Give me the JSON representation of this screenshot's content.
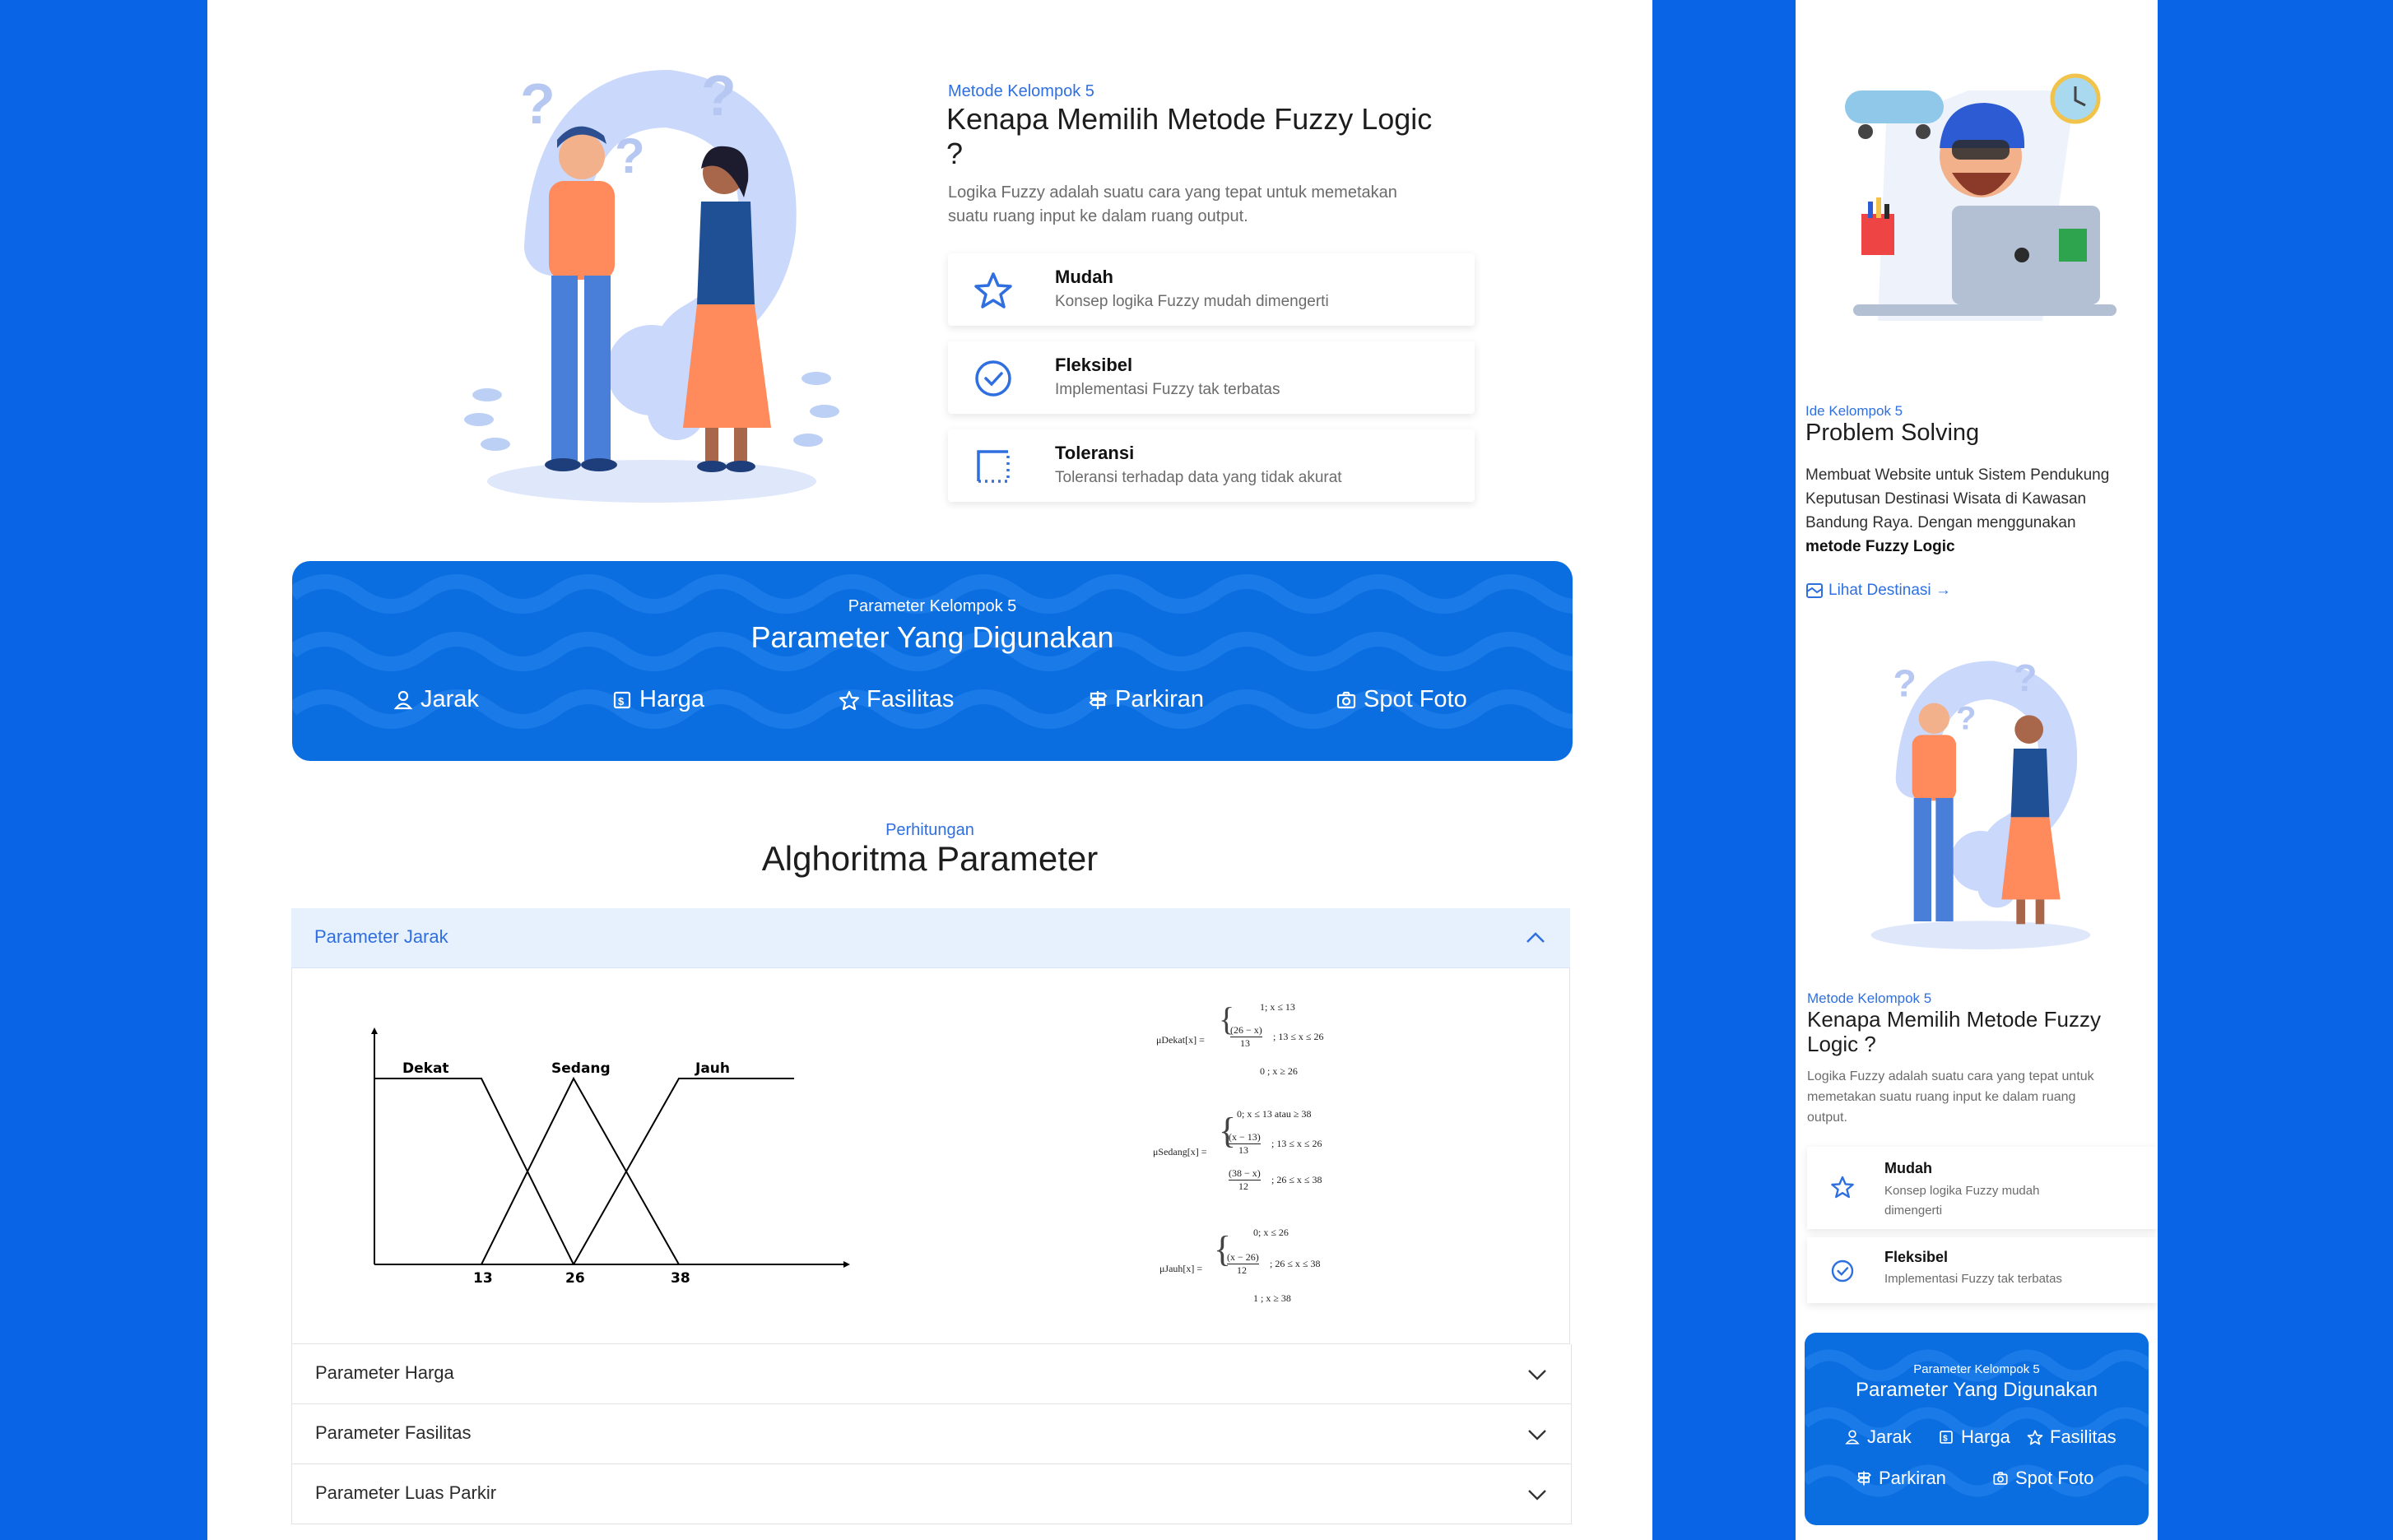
{
  "desktop": {
    "why": {
      "eyebrow": "Metode Kelompok 5",
      "title_line1": "Kenapa Memilih Metode Fuzzy Logic",
      "title_line2": "?",
      "desc_line1": "Logika Fuzzy adalah suatu cara yang tepat untuk memetakan",
      "desc_line2": "suatu ruang input ke dalam ruang output.",
      "features": [
        {
          "title": "Mudah",
          "desc": "Konsep logika Fuzzy mudah dimengerti",
          "icon": "star-icon"
        },
        {
          "title": "Fleksibel",
          "desc": "Implementasi Fuzzy tak terbatas",
          "icon": "check-circle-icon"
        },
        {
          "title": "Toleransi",
          "desc": "Toleransi terhadap data yang tidak akurat",
          "icon": "dashed-square-icon"
        }
      ]
    },
    "params": {
      "eyebrow": "Parameter Kelompok 5",
      "title": "Parameter Yang Digunakan",
      "items": [
        "Jarak",
        "Harga",
        "Fasilitas",
        "Parkiran",
        "Spot Foto"
      ]
    },
    "algo": {
      "eyebrow": "Perhitungan",
      "title": "Alghoritma Parameter",
      "open_label": "Parameter Jarak",
      "rows": [
        "Parameter Harga",
        "Parameter Fasilitas",
        "Parameter Luas Parkir"
      ],
      "graph": {
        "labels": [
          "Dekat",
          "Sedang",
          "Jauh"
        ],
        "ticks": [
          "13",
          "26",
          "38"
        ]
      },
      "formulas": {
        "dekat": {
          "name": "μDekat[x] =",
          "c1": "1; x ≤ 13",
          "c2a": "(26 − x)",
          "c2b": "13",
          "c2c": "; 13 ≤ x ≤ 26",
          "c3": "0 ; x ≥ 26"
        },
        "sedang": {
          "name": "μSedang[x] =",
          "c1": "0; x ≤ 13 atau ≥ 38",
          "c2a": "(x − 13)",
          "c2b": "13",
          "c2c": "; 13 ≤ x ≤ 26",
          "c3a": "(38 − x)",
          "c3b": "12",
          "c3c": "; 26 ≤ x ≤ 38"
        },
        "jauh": {
          "name": "μJauh[x] =",
          "c1": "0; x ≤ 26",
          "c2a": "(x − 26)",
          "c2b": "12",
          "c2c": "; 26 ≤ x ≤ 38",
          "c3": "1 ; x ≥ 38"
        }
      }
    }
  },
  "mobile": {
    "problem": {
      "eyebrow": "Ide Kelompok 5",
      "title": "Problem Solving",
      "desc_line1": "Membuat Website untuk Sistem Pendukung",
      "desc_line2": "Keputusan Destinasi Wisata di Kawasan",
      "desc_line3": "Bandung Raya. Dengan menggunakan",
      "desc_bold": "metode Fuzzy Logic",
      "link": "Lihat Destinasi →"
    },
    "why": {
      "eyebrow": "Metode Kelompok 5",
      "title_line1": "Kenapa Memilih Metode Fuzzy",
      "title_line2": "Logic ?",
      "desc_line1": "Logika Fuzzy adalah suatu cara yang tepat untuk",
      "desc_line2": "memetakan suatu ruang input ke dalam ruang",
      "desc_line3": "output.",
      "features": [
        {
          "title": "Mudah",
          "desc_line1": "Konsep logika Fuzzy mudah",
          "desc_line2": "dimengerti",
          "icon": "star-icon"
        },
        {
          "title": "Fleksibel",
          "desc_line1": "Implementasi Fuzzy tak terbatas",
          "desc_line2": "",
          "icon": "check-circle-icon"
        }
      ]
    },
    "params": {
      "eyebrow": "Parameter Kelompok 5",
      "title": "Parameter Yang Digunakan",
      "items": [
        "Jarak",
        "Harga",
        "Fasilitas",
        "Parkiran",
        "Spot Foto"
      ]
    }
  },
  "colors": {
    "page_bg": "#0a64e6",
    "accent": "#2f6fe0",
    "banner": "#0b6ee0",
    "accordion_active_bg": "#e7f0fd"
  }
}
